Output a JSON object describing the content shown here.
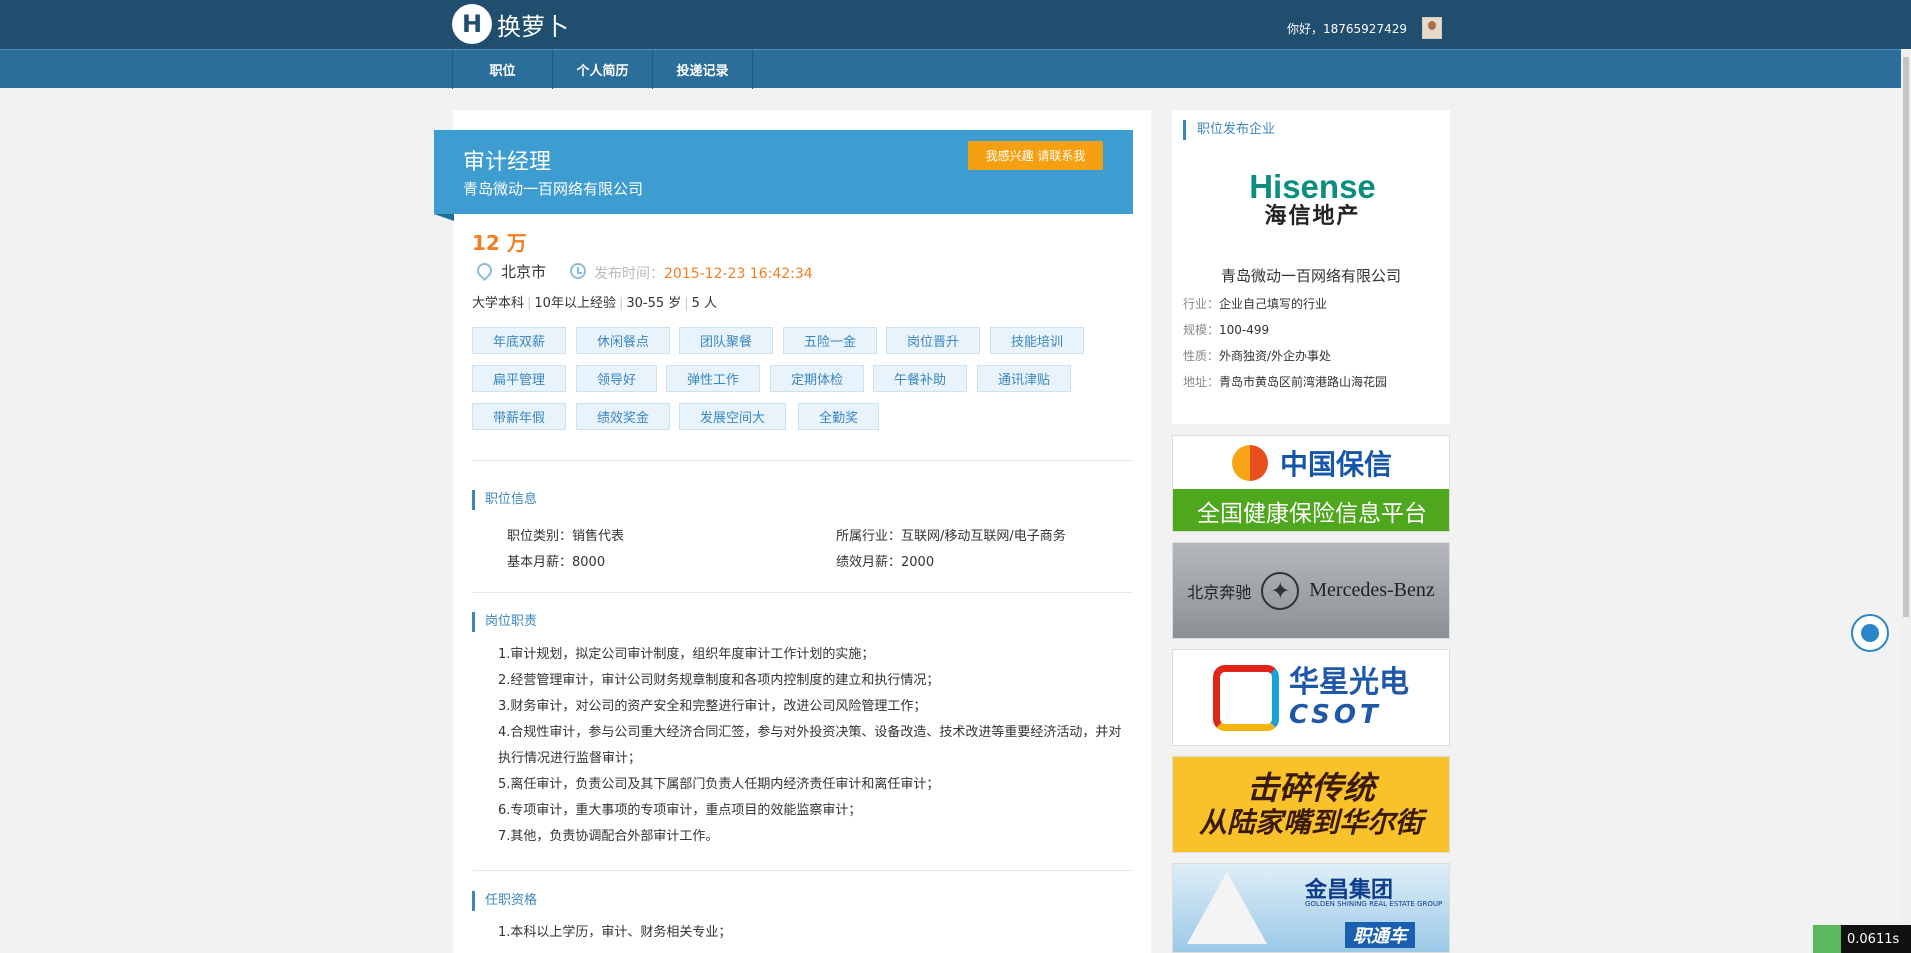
{
  "header": {
    "logo_mark": "H",
    "logo_text": "换萝卜",
    "greeting": "你好，18765927429"
  },
  "nav": {
    "items": [
      "职位",
      "个人简历",
      "投递记录"
    ]
  },
  "job": {
    "title": "审计经理",
    "company": "青岛微动一百网络有限公司",
    "interest_button": "我感兴趣 请联系我",
    "salary": "12 万",
    "location": "北京市",
    "publish_label": "发布时间：",
    "publish_time": "2015-12-23 16:42:34",
    "education": "大学本科",
    "experience": "10年以上经验",
    "age": "30-55 岁",
    "headcount": "5 人",
    "tags": [
      "年底双薪",
      "休闲餐点",
      "团队聚餐",
      "五险一金",
      "岗位晋升",
      "技能培训",
      "扁平管理",
      "领导好",
      "弹性工作",
      "定期体检",
      "午餐补助",
      "通讯津贴",
      "带薪年假",
      "绩效奖金",
      "发展空间大",
      "全勤奖"
    ]
  },
  "position_info": {
    "title": "职位信息",
    "category": "职位类别：销售代表",
    "industry": "所属行业：互联网/移动互联网/电子商务",
    "base_salary": "基本月薪：8000",
    "performance_salary": "绩效月薪：2000"
  },
  "duties": {
    "title": "岗位职责",
    "items": [
      "1.审计规划，拟定公司审计制度，组织年度审计工作计划的实施；",
      "2.经营管理审计，审计公司财务规章制度和各项内控制度的建立和执行情况；",
      "3.财务审计，对公司的资产安全和完整进行审计，改进公司风险管理工作；",
      "4.合规性审计，参与公司重大经济合同汇签，参与对外投资决策、设备改造、技术改进等重要经济活动，并对执行情况进行监督审计；",
      "5.离任审计，负责公司及其下属部门负责人任期内经济责任审计和离任审计；",
      "6.专项审计，重大事项的专项审计，重点项目的效能监察审计；",
      "7.其他，负责协调配合外部审计工作。"
    ]
  },
  "qualifications": {
    "title": "任职资格",
    "items": [
      "1.本科以上学历，审计、财务相关专业；"
    ]
  },
  "sidebar": {
    "title": "职位发布企业",
    "logo_en": "Hisense",
    "logo_cn": "海信地产",
    "company": "青岛微动一百网络有限公司",
    "industry_label": "行业：",
    "industry": "企业自己填写的行业",
    "scale_label": "规模：",
    "scale": "100-499",
    "nature_label": "性质：",
    "nature": "外商独资/外企办事处",
    "address_label": "地址：",
    "address": "青岛市黄岛区前湾港路山海花园"
  },
  "ads": {
    "ad1_title": "中国保信",
    "ad1_sub": "全国健康保险信息平台",
    "ad2_cn": "北京奔驰",
    "ad2_en": "Mercedes-Benz",
    "ad3_cn": "华星光电",
    "ad3_en": "CSOT",
    "ad4_l1": "击碎传统",
    "ad4_l2": "从陆家嘴到华尔街",
    "ad5_title": "金昌集团",
    "ad5_sub": "GOLDEN SHINING REAL ESTATE GROUP",
    "ad5_tag": "职通车"
  },
  "timer": "0.0611s",
  "colors": {
    "topbar": "#1f4e6e",
    "navbar": "#2a6e99",
    "accent": "#3d9cd0",
    "orange": "#f47d20",
    "button": "#f5a012"
  }
}
